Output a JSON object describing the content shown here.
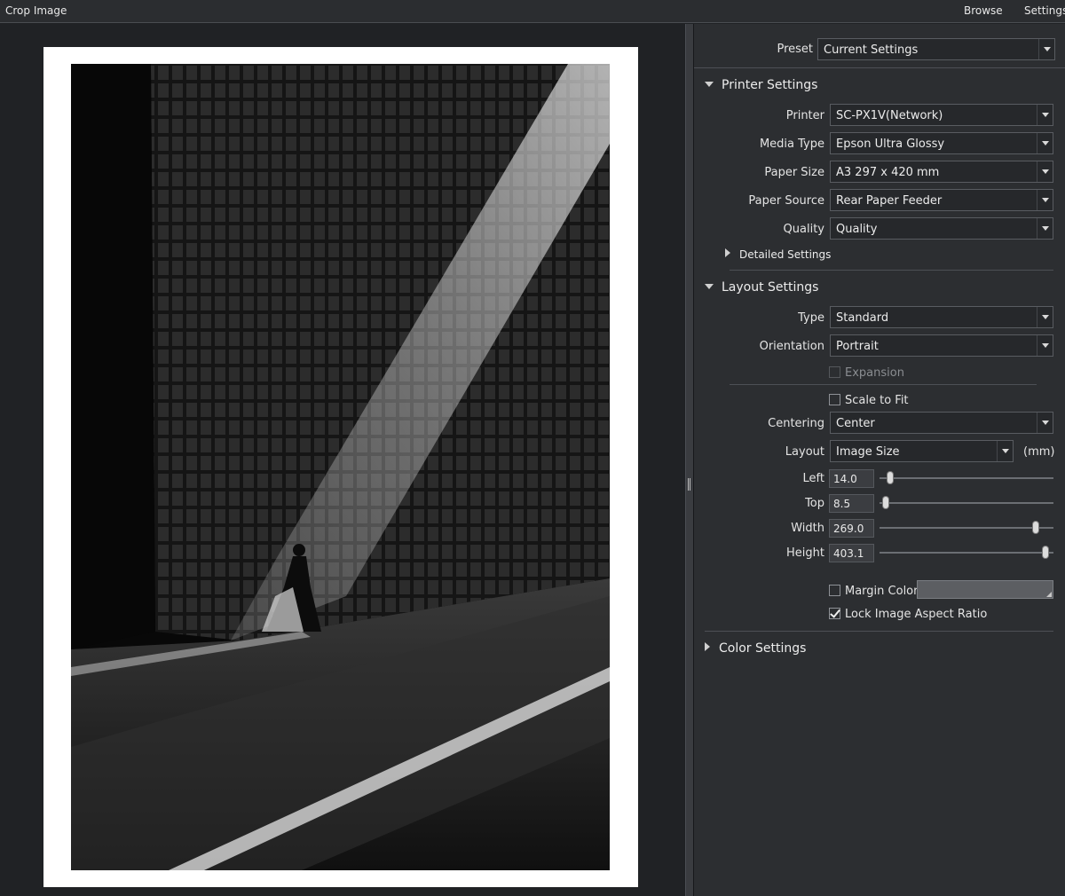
{
  "topbar": {
    "title": "Crop Image",
    "menu": [
      "Browse",
      "Settings"
    ]
  },
  "preview": {
    "image": "black-and-white photo of a glass-block wall lit by a diagonal shaft of light, a woman walking on a brick sidewalk"
  },
  "preset": {
    "label": "Preset",
    "value": "Current Settings"
  },
  "printer_settings": {
    "heading": "Printer Settings",
    "fields": [
      {
        "label": "Printer",
        "value": "SC-PX1V(Network)"
      },
      {
        "label": "Media Type",
        "value": "Epson Ultra Glossy"
      },
      {
        "label": "Paper Size",
        "value": "A3 297 x 420 mm"
      },
      {
        "label": "Paper Source",
        "value": "Rear Paper Feeder"
      },
      {
        "label": "Quality",
        "value": "Quality"
      }
    ],
    "detailed": "Detailed Settings"
  },
  "layout_settings": {
    "heading": "Layout Settings",
    "type": {
      "label": "Type",
      "value": "Standard"
    },
    "orientation": {
      "label": "Orientation",
      "value": "Portrait"
    },
    "expansion": {
      "label": "Expansion",
      "checked": false,
      "enabled": false
    },
    "scale_to_fit": {
      "label": "Scale to Fit",
      "checked": false
    },
    "centering": {
      "label": "Centering",
      "value": "Center"
    },
    "layout": {
      "label": "Layout",
      "value": "Image Size",
      "unit": "(mm)"
    },
    "dimensions": [
      {
        "label": "Left",
        "value": "14.0",
        "slider": 0.06
      },
      {
        "label": "Top",
        "value": "8.5",
        "slider": 0.035
      },
      {
        "label": "Width",
        "value": "269.0",
        "slider": 0.9
      },
      {
        "label": "Height",
        "value": "403.1",
        "slider": 0.955
      }
    ],
    "margin_color": {
      "label": "Margin Color",
      "checked": false,
      "color": "#5c5e62"
    },
    "lock_aspect": {
      "label": "Lock Image Aspect Ratio",
      "checked": true
    }
  },
  "color_settings": {
    "heading": "Color Settings"
  }
}
